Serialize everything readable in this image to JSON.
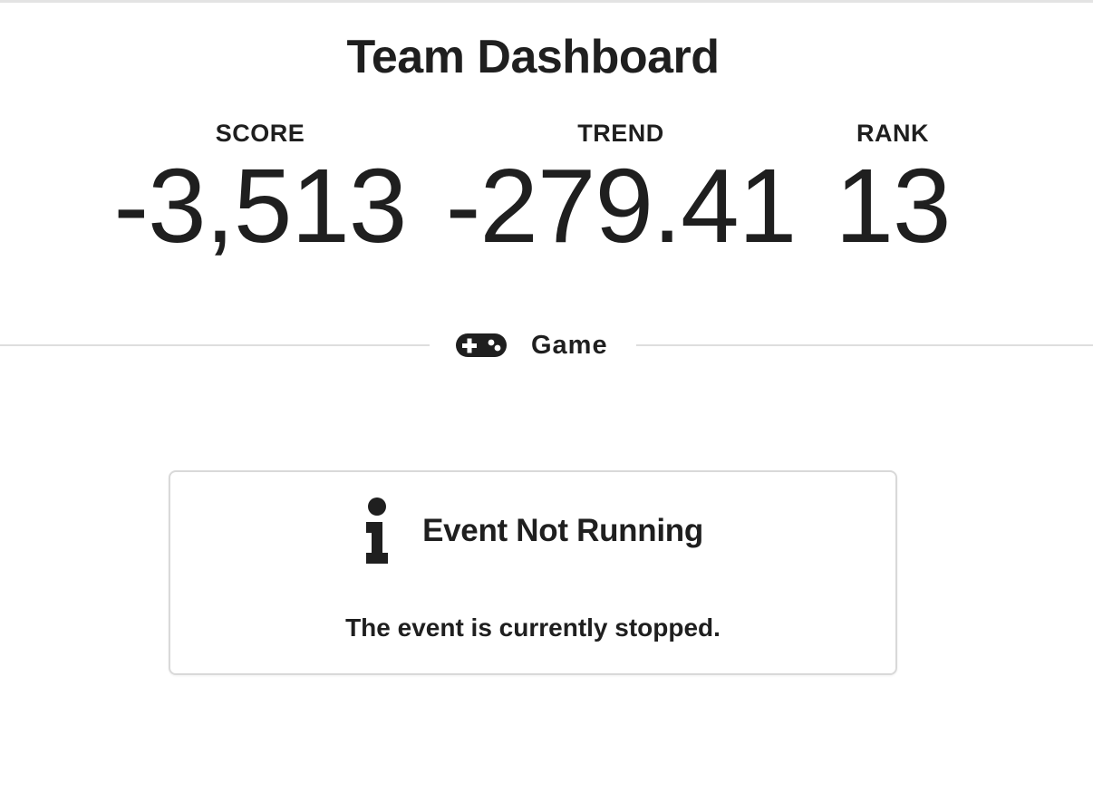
{
  "header": {
    "title": "Team Dashboard"
  },
  "stats": {
    "score": {
      "label": "SCORE",
      "value": "-3,513"
    },
    "trend": {
      "label": "TREND",
      "value": "-279.41"
    },
    "rank": {
      "label": "RANK",
      "value": "13"
    }
  },
  "section": {
    "label": "Game",
    "icon": "gamepad-icon"
  },
  "message": {
    "icon": "info-icon",
    "title": "Event Not Running",
    "body": "The event is currently stopped."
  },
  "colors": {
    "text": "#1f1f1f",
    "divider": "#dedede",
    "border": "#d9d9d9"
  }
}
